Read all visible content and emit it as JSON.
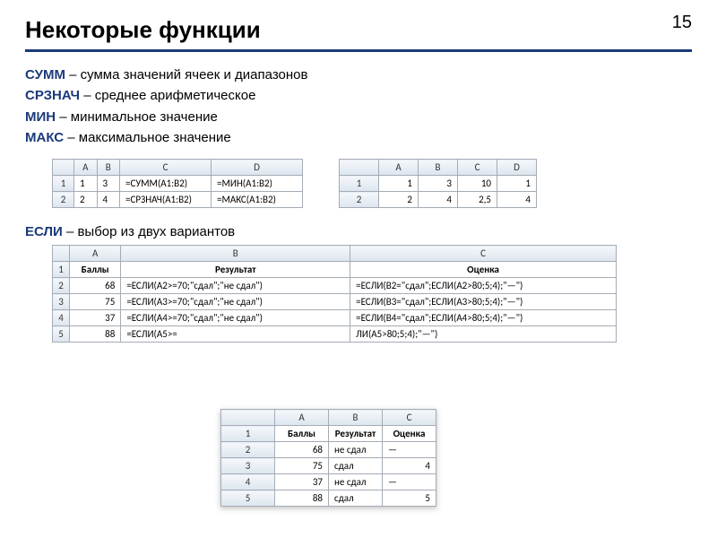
{
  "page_number": "15",
  "title": "Некоторые функции",
  "functions": [
    {
      "name": "СУММ",
      "desc": " – сумма значений ячеек и диапазонов"
    },
    {
      "name": "СРЗНАЧ",
      "desc": " – среднее арифметическое"
    },
    {
      "name": "МИН",
      "desc": " – минимальное значение"
    },
    {
      "name": "МАКС",
      "desc": " – максимальное значение"
    }
  ],
  "table1": {
    "cols": [
      "A",
      "B",
      "C",
      "D"
    ],
    "r1": {
      "n": "1",
      "a": "1",
      "b": "3",
      "c": "=СУММ(A1:B2)",
      "d": "=МИН(A1:B2)"
    },
    "r2": {
      "n": "2",
      "a": "2",
      "b": "4",
      "c": "=СРЗНАЧ(A1:B2)",
      "d": "=МАКС(A1:B2)"
    }
  },
  "table2": {
    "cols": [
      "A",
      "B",
      "C",
      "D"
    ],
    "r1": {
      "n": "1",
      "a": "1",
      "b": "3",
      "c": "10",
      "d": "1"
    },
    "r2": {
      "n": "2",
      "a": "2",
      "b": "4",
      "c": "2,5",
      "d": "4"
    }
  },
  "if_line": {
    "name": "ЕСЛИ",
    "desc": " – выбор из двух вариантов"
  },
  "table3": {
    "cols": [
      "A",
      "B",
      "C"
    ],
    "hdr": {
      "a": "Баллы",
      "b": "Результат",
      "c": "Оценка"
    },
    "rows": [
      {
        "n": "2",
        "a": "68",
        "b": "=ЕСЛИ(A2>=70;\"сдал\";\"не сдал\")",
        "c": "=ЕСЛИ(B2=\"сдал\";ЕСЛИ(A2>80;5;4);\"—\")"
      },
      {
        "n": "3",
        "a": "75",
        "b": "=ЕСЛИ(A3>=70;\"сдал\";\"не сдал\")",
        "c": "=ЕСЛИ(B3=\"сдал\";ЕСЛИ(A3>80;5;4);\"—\")"
      },
      {
        "n": "4",
        "a": "37",
        "b": "=ЕСЛИ(A4>=70;\"сдал\";\"не сдал\")",
        "c": "=ЕСЛИ(B4=\"сдал\";ЕСЛИ(A4>80;5;4);\"—\")"
      },
      {
        "n": "5",
        "a": "88",
        "b": "=ЕСЛИ(A5>=",
        "c": "ЛИ(A5>80;5;4);\"—\")"
      }
    ]
  },
  "table4": {
    "cols": [
      "A",
      "B",
      "C"
    ],
    "hdr": {
      "a": "Баллы",
      "b": "Результат",
      "c": "Оценка"
    },
    "rows": [
      {
        "n": "2",
        "a": "68",
        "b": "не сдал",
        "c": "—"
      },
      {
        "n": "3",
        "a": "75",
        "b": "сдал",
        "c": "4"
      },
      {
        "n": "4",
        "a": "37",
        "b": "не сдал",
        "c": "—"
      },
      {
        "n": "5",
        "a": "88",
        "b": "сдал",
        "c": "5"
      }
    ]
  }
}
